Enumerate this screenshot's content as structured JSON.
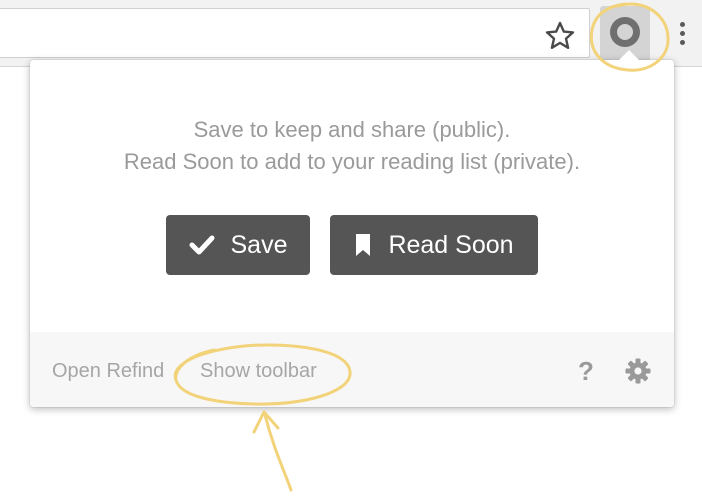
{
  "browser": {
    "star_icon": "star-icon",
    "extension_icon": "refind-extension-icon",
    "menu_icon": "vertical-dots-icon"
  },
  "popup": {
    "message_line1": "Save to keep and share (public).",
    "message_line2": "Read Soon to add to your reading list (private).",
    "save_label": "Save",
    "save_icon": "checkmark-icon",
    "read_soon_label": "Read Soon",
    "read_soon_icon": "bookmark-icon",
    "footer": {
      "open_label": "Open Refind",
      "toolbar_label": "Show toolbar",
      "help_label": "?",
      "settings_icon": "gear-icon"
    }
  },
  "colors": {
    "button_bg": "#555555",
    "annotation": "#f2d37a",
    "muted_text": "#9a9a9a"
  }
}
